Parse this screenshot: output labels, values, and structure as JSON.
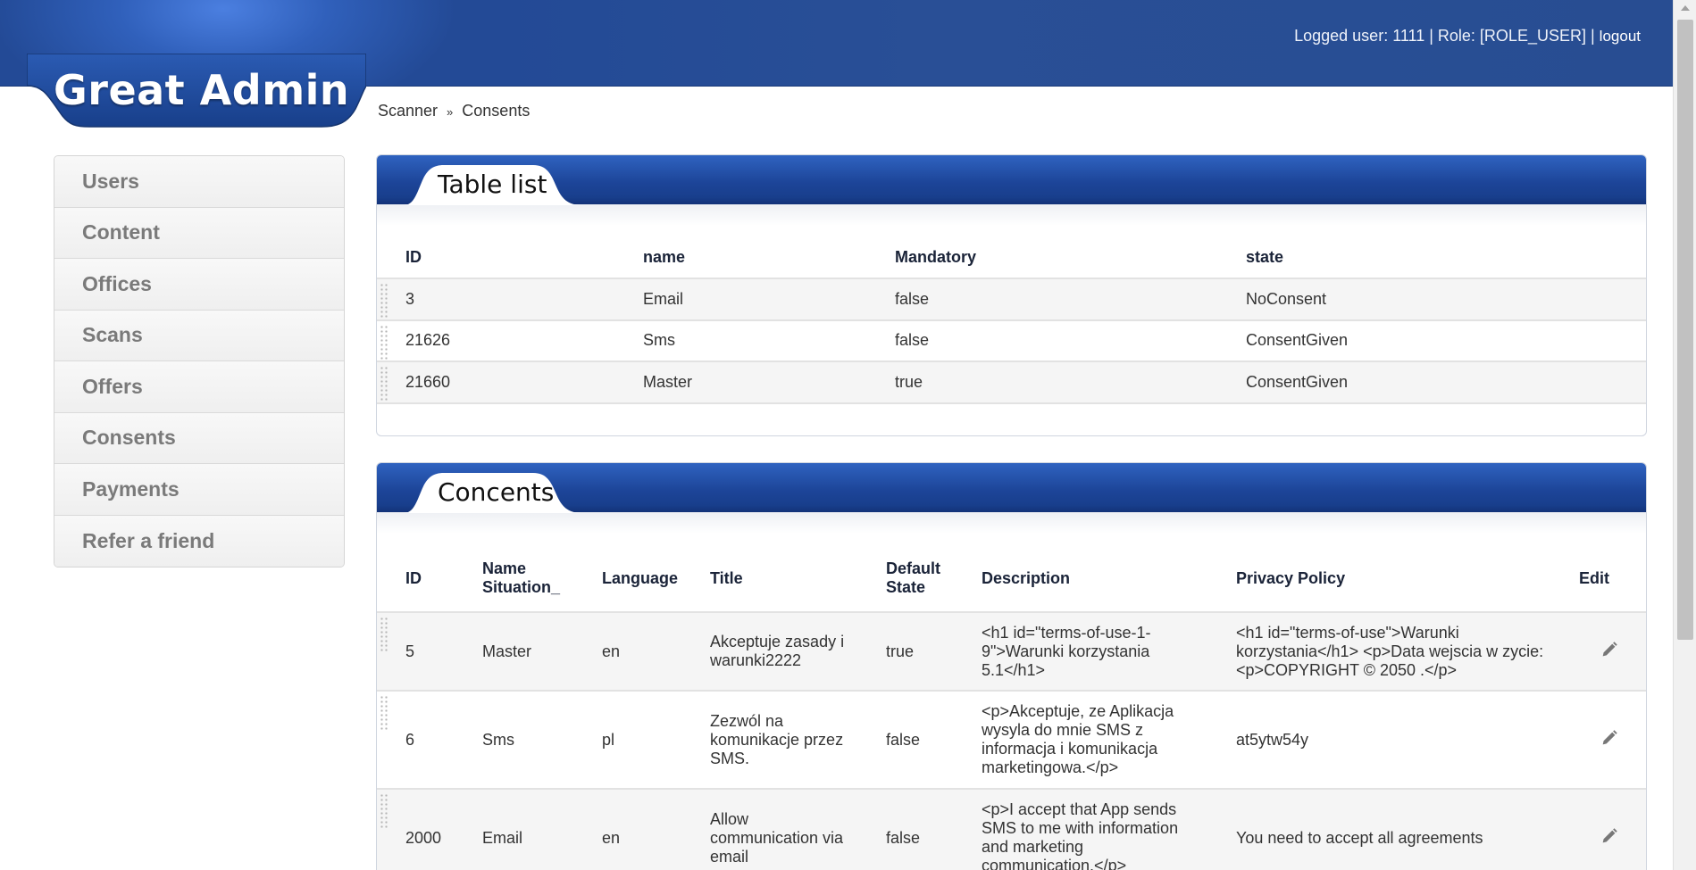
{
  "brand": {
    "logo": "Great Admin"
  },
  "user_bar": {
    "logged_user_label": "Logged user: 1111 | Role: [ROLE_USER] |",
    "logout_label": "logout"
  },
  "breadcrumb": {
    "items": [
      "Scanner",
      "Consents"
    ],
    "separator": "»"
  },
  "sidebar": {
    "items": [
      {
        "label": "Users"
      },
      {
        "label": "Content"
      },
      {
        "label": "Offices"
      },
      {
        "label": "Scans"
      },
      {
        "label": "Offers"
      },
      {
        "label": "Consents"
      },
      {
        "label": "Payments"
      },
      {
        "label": "Refer a friend"
      }
    ]
  },
  "table_list": {
    "title": "Table list",
    "columns": [
      "ID",
      "name",
      "Mandatory",
      "state"
    ],
    "rows": [
      [
        "3",
        "Email",
        "false",
        "NoConsent"
      ],
      [
        "21626",
        "Sms",
        "false",
        "ConsentGiven"
      ],
      [
        "21660",
        "Master",
        "true",
        "ConsentGiven"
      ]
    ]
  },
  "concents": {
    "title": "Concents",
    "columns": [
      "ID",
      "Name Situation_",
      "Language",
      "Title",
      "Default State",
      "Description",
      "Privacy Policy",
      "Edit"
    ],
    "rows": [
      [
        "5",
        "Master",
        "en",
        "Akceptuje zasady i warunki2222",
        "true",
        "<h1 id=\"terms-of-use-1-9\">Warunki korzystania 5.1</h1>",
        "<h1 id=\"terms-of-use\">Warunki korzystania</h1> <p>Data wejscia w zycie: <p>COPYRIGHT © 2050 .</p>"
      ],
      [
        "6",
        "Sms",
        "pl",
        "Zezwól na komunikacje przez SMS.",
        "false",
        "<p>Akceptuje, ze Aplikacja wysyla do mnie SMS z informacja i komunikacja marketingowa.</p>",
        "at5ytw54y"
      ],
      [
        "2000",
        "Email",
        "en",
        "Allow communication via email",
        "false",
        "<p>I accept that App sends SMS to me with information and marketing communication.</p>",
        "You need to accept all agreements"
      ]
    ]
  },
  "colors": {
    "header_blue": "#234a96",
    "panel_blue": "#1d4599",
    "sidebar_text": "#7a7a7a"
  },
  "icons": {
    "edit": "pencil-icon",
    "row_handle": "drag-handle-icon"
  }
}
